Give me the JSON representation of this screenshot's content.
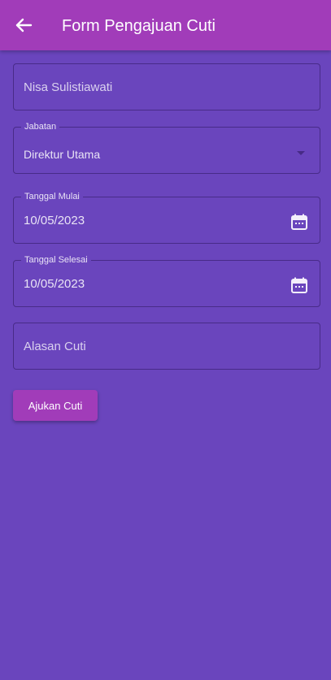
{
  "appbar": {
    "title": "Form Pengajuan Cuti",
    "back_icon": "arrow-left-icon",
    "color": "#a13cb9"
  },
  "background": "#6a45bd",
  "form": {
    "name": {
      "value": "Nisa Sulistiawati"
    },
    "jabatan": {
      "label": "Jabatan",
      "value": "Direktur Utama"
    },
    "tanggal_mulai": {
      "label": "Tanggal Mulai",
      "value": "10/05/2023",
      "icon": "calendar-icon"
    },
    "tanggal_selesai": {
      "label": "Tanggal Selesai",
      "value": "10/05/2023",
      "icon": "calendar-icon"
    },
    "alasan": {
      "placeholder": "Alasan Cuti"
    },
    "submit_label": "Ajukan Cuti"
  }
}
